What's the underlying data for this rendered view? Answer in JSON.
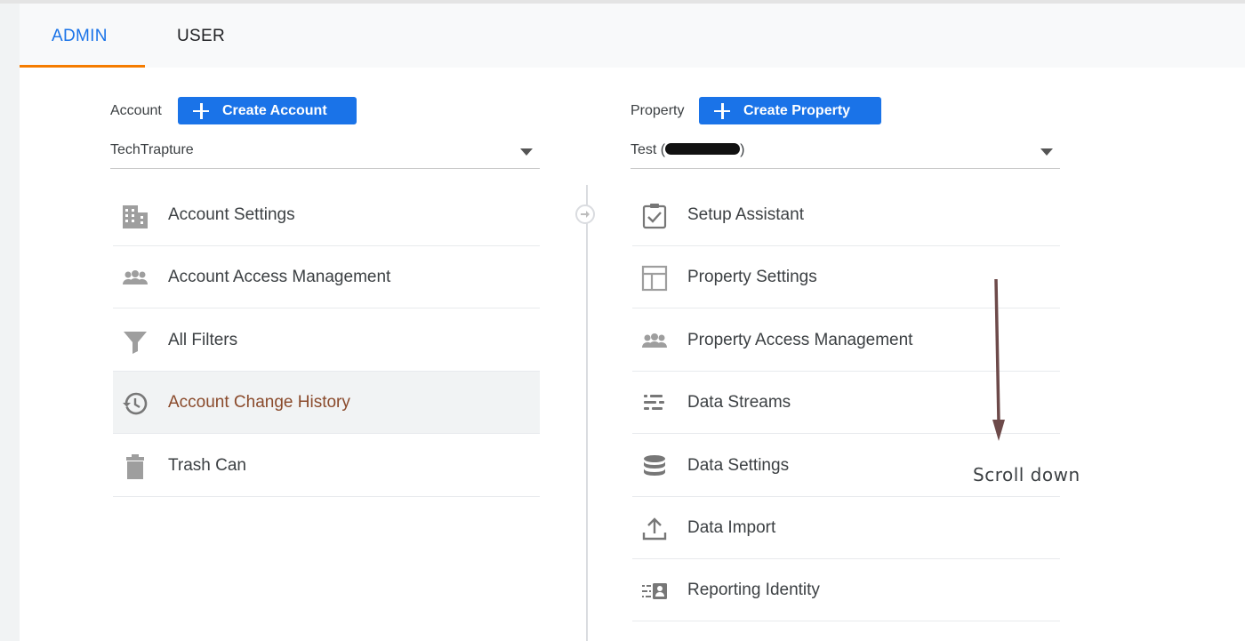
{
  "tabs": {
    "admin": "ADMIN",
    "user": "USER"
  },
  "account": {
    "label": "Account",
    "create_button": "Create Account",
    "selected": "TechTrapture",
    "items": [
      {
        "label": "Account Settings",
        "icon": "building-icon"
      },
      {
        "label": "Account Access Management",
        "icon": "people-icon"
      },
      {
        "label": "All Filters",
        "icon": "filter-icon"
      },
      {
        "label": "Account Change History",
        "icon": "history-icon"
      },
      {
        "label": "Trash Can",
        "icon": "trash-icon"
      }
    ]
  },
  "property": {
    "label": "Property",
    "create_button": "Create Property",
    "selected_prefix": "Test (",
    "selected_suffix": ")",
    "items": [
      {
        "label": "Setup Assistant",
        "icon": "checklist-icon"
      },
      {
        "label": "Property Settings",
        "icon": "layout-icon"
      },
      {
        "label": "Property Access Management",
        "icon": "people-icon"
      },
      {
        "label": "Data Streams",
        "icon": "streams-icon"
      },
      {
        "label": "Data Settings",
        "icon": "database-icon"
      },
      {
        "label": "Data Import",
        "icon": "upload-icon"
      },
      {
        "label": "Reporting Identity",
        "icon": "identity-icon"
      }
    ]
  },
  "annotation": {
    "text": "Scroll down",
    "color": "#6d4a4a"
  },
  "colors": {
    "accent": "#1a73e8",
    "tab_underline": "#f57c00",
    "active_item_text": "#8a4a2b"
  }
}
